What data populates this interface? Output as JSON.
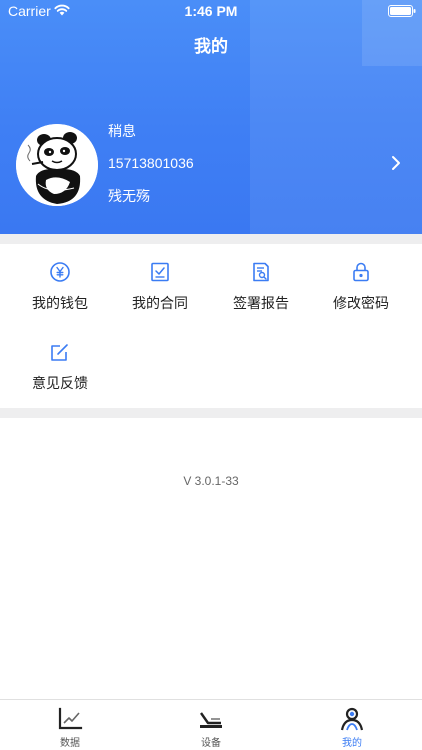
{
  "status_bar": {
    "carrier": "Carrier",
    "time": "1:46 PM"
  },
  "page_title": "我的",
  "profile": {
    "name": "稍息",
    "phone": "15713801036",
    "nickname": "残无殇"
  },
  "menu": {
    "wallet": "我的钱包",
    "contract": "我的合同",
    "report": "签署报告",
    "password": "修改密码",
    "feedback": "意见反馈"
  },
  "version": "V 3.0.1-33",
  "tabbar": {
    "data": "数据",
    "device": "设备",
    "mine": "我的",
    "active": "mine"
  },
  "colors": {
    "accent": "#3b7cf3",
    "header_gradient_top": "#4a8ef8",
    "header_gradient_bottom": "#3a78f2",
    "divider": "#eeeeef"
  }
}
